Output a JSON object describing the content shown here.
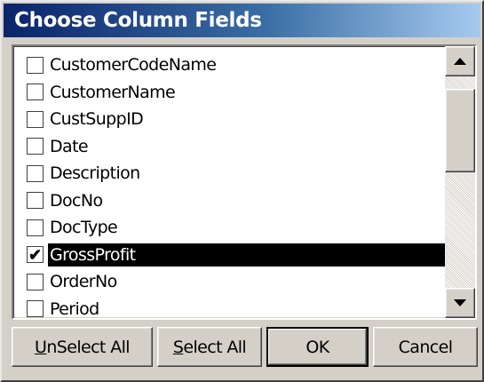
{
  "dialog": {
    "title": "Choose Column Fields",
    "title_colors": [
      "#0a246a",
      "#a6caf0"
    ]
  },
  "fields": [
    {
      "label": "CustomerCodeName",
      "checked": false,
      "selected": false
    },
    {
      "label": "CustomerName",
      "checked": false,
      "selected": false
    },
    {
      "label": "CustSuppID",
      "checked": false,
      "selected": false
    },
    {
      "label": "Date",
      "checked": false,
      "selected": false
    },
    {
      "label": "Description",
      "checked": false,
      "selected": false
    },
    {
      "label": "DocNo",
      "checked": false,
      "selected": false
    },
    {
      "label": "DocType",
      "checked": false,
      "selected": false
    },
    {
      "label": "GrossProfit",
      "checked": true,
      "selected": true
    },
    {
      "label": "OrderNo",
      "checked": false,
      "selected": false
    },
    {
      "label": "Period",
      "checked": false,
      "selected": false
    }
  ],
  "check_glyph": "✔",
  "scrollbar": {
    "up_icon": "up-arrow-icon",
    "down_icon": "down-arrow-icon"
  },
  "buttons": {
    "unselect_all": {
      "mnemonic": "U",
      "rest": "nSelect All"
    },
    "select_all": {
      "mnemonic": "S",
      "rest": "elect All"
    },
    "ok": "OK",
    "cancel": "Cancel"
  }
}
